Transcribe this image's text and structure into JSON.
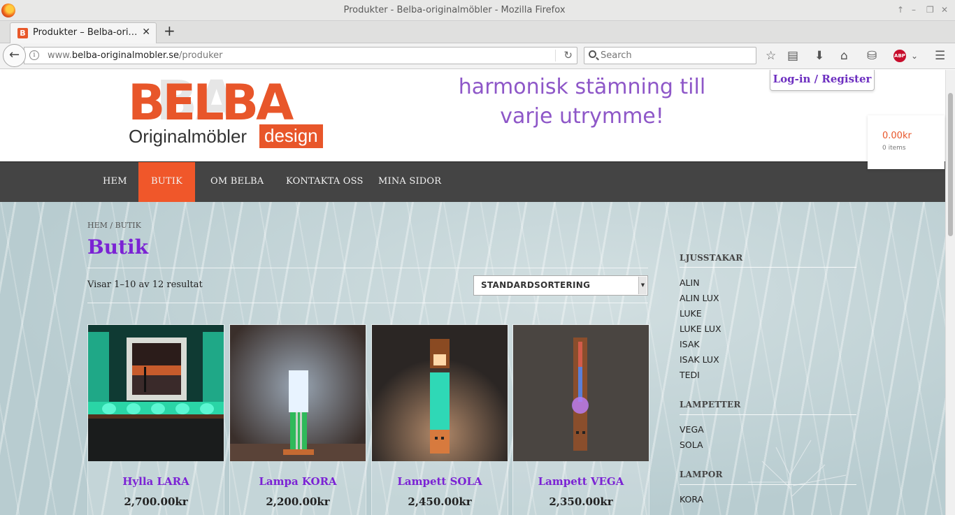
{
  "window": {
    "title": "Produkter - Belba-originalmöbler - Mozilla Firefox"
  },
  "tab": {
    "label": "Produkter – Belba-ori…",
    "favicon": "B"
  },
  "address_bar": {
    "url_prefix": "www.",
    "url_host": "belba-originalmobler.se",
    "url_path": "/produker"
  },
  "search_bar": {
    "placeholder": "Search"
  },
  "header": {
    "logo_word": "BELBA",
    "logo_sub": "Originalmöbler",
    "logo_design": "design",
    "tagline_1": "harmonisk stämning till",
    "tagline_2": "varje utrymme!",
    "login_label": "Log-in / Register",
    "cart_amount": "0.00kr",
    "cart_count": "0 items"
  },
  "nav": [
    {
      "label": "HEM",
      "active": false
    },
    {
      "label": "BUTIK",
      "active": true
    },
    {
      "label": "OM BELBA",
      "active": false
    },
    {
      "label": "KONTAKTA OSS",
      "active": false
    },
    {
      "label": "MINA SIDOR",
      "active": false
    }
  ],
  "breadcrumb": "HEM / BUTIK",
  "page_title": "Butik",
  "result_count": "Visar 1–10 av 12 resultat",
  "sort": {
    "selected": "STANDARDSORTERING"
  },
  "products": [
    {
      "name": "Hylla LARA",
      "price": "2,700.00kr"
    },
    {
      "name": "Lampa KORA",
      "price": "2,200.00kr"
    },
    {
      "name": "Lampett SOLA",
      "price": "2,450.00kr"
    },
    {
      "name": "Lampett VEGA",
      "price": "2,350.00kr"
    }
  ],
  "sidebar": {
    "sections": [
      {
        "title": "LJUSSTAKAR",
        "items": [
          "ALIN",
          "ALIN LUX",
          "LUKE",
          "LUKE LUX",
          "ISAK",
          "ISAK LUX",
          "TEDI"
        ]
      },
      {
        "title": "LAMPETTER",
        "items": [
          "VEGA",
          "SOLA"
        ]
      },
      {
        "title": "LAMPOR",
        "items": [
          "KORA"
        ]
      }
    ]
  },
  "colors": {
    "accent": "#f0572a",
    "brand_purple": "#7b22d4",
    "nav_bg": "#444444"
  },
  "icons": [
    "firefox-icon",
    "back-arrow-icon",
    "info-icon",
    "reload-icon",
    "search-icon",
    "bookmark-star-icon",
    "reading-list-icon",
    "download-icon",
    "home-icon",
    "pocket-icon",
    "adblock-icon",
    "menu-icon"
  ]
}
